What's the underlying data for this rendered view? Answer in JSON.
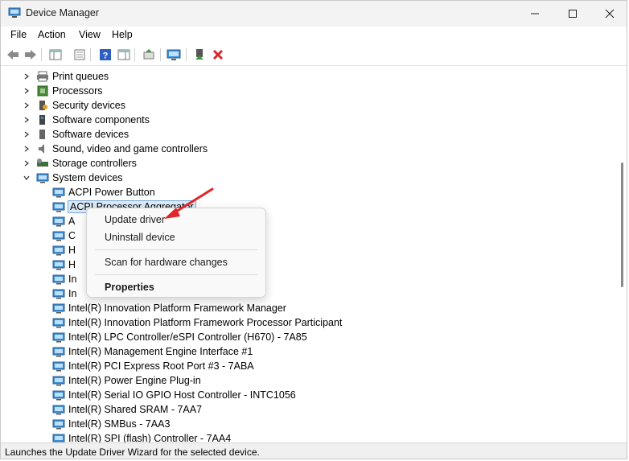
{
  "window": {
    "title": "Device Manager",
    "controls": [
      "minimize",
      "maximize",
      "close"
    ]
  },
  "menu": [
    "File",
    "Action",
    "View",
    "Help"
  ],
  "toolbar": {
    "buttons": [
      "back-icon",
      "forward-icon",
      "show-hide-console-tree-icon",
      "properties-icon",
      "help-icon",
      "action-pane-icon",
      "update-driver-icon",
      "scan-hardware-icon",
      "enable-device-icon",
      "uninstall-device-icon"
    ]
  },
  "tree": {
    "categories": [
      {
        "label": "Print queues",
        "expanded": false
      },
      {
        "label": "Processors",
        "expanded": false
      },
      {
        "label": "Security devices",
        "expanded": false
      },
      {
        "label": "Software components",
        "expanded": false
      },
      {
        "label": "Software devices",
        "expanded": false
      },
      {
        "label": "Sound, video and game controllers",
        "expanded": false
      },
      {
        "label": "Storage controllers",
        "expanded": false
      },
      {
        "label": "System devices",
        "expanded": true
      }
    ],
    "devices": [
      {
        "label": "ACPI Power Button"
      },
      {
        "label": "ACPI Processor Aggregator",
        "selected": true
      },
      {
        "label": "A"
      },
      {
        "label": "C"
      },
      {
        "label": "H"
      },
      {
        "label": "H"
      },
      {
        "label": "In"
      },
      {
        "label": "In"
      },
      {
        "label": "Intel(R) Innovation Platform Framework Manager"
      },
      {
        "label": "Intel(R) Innovation Platform Framework Processor Participant"
      },
      {
        "label": "Intel(R) LPC Controller/eSPI Controller (H670) - 7A85"
      },
      {
        "label": "Intel(R) Management Engine Interface #1"
      },
      {
        "label": "Intel(R) PCI Express Root Port #3 - 7ABA"
      },
      {
        "label": "Intel(R) Power Engine Plug-in"
      },
      {
        "label": "Intel(R) Serial IO GPIO Host Controller - INTC1056"
      },
      {
        "label": "Intel(R) Shared SRAM - 7AA7"
      },
      {
        "label": "Intel(R) SMBus - 7AA3"
      },
      {
        "label": "Intel(R) SPI (flash) Controller - 7AA4"
      }
    ]
  },
  "context_menu": {
    "items": [
      "Update driver",
      "Uninstall device",
      "Scan for hardware changes",
      "Properties"
    ]
  },
  "status": "Launches the Update Driver Wizard for the selected device.",
  "colors": {
    "annotation_arrow": "#e0262b",
    "selection_fill": "#dceaf8",
    "selection_border": "#7aa7d7"
  }
}
